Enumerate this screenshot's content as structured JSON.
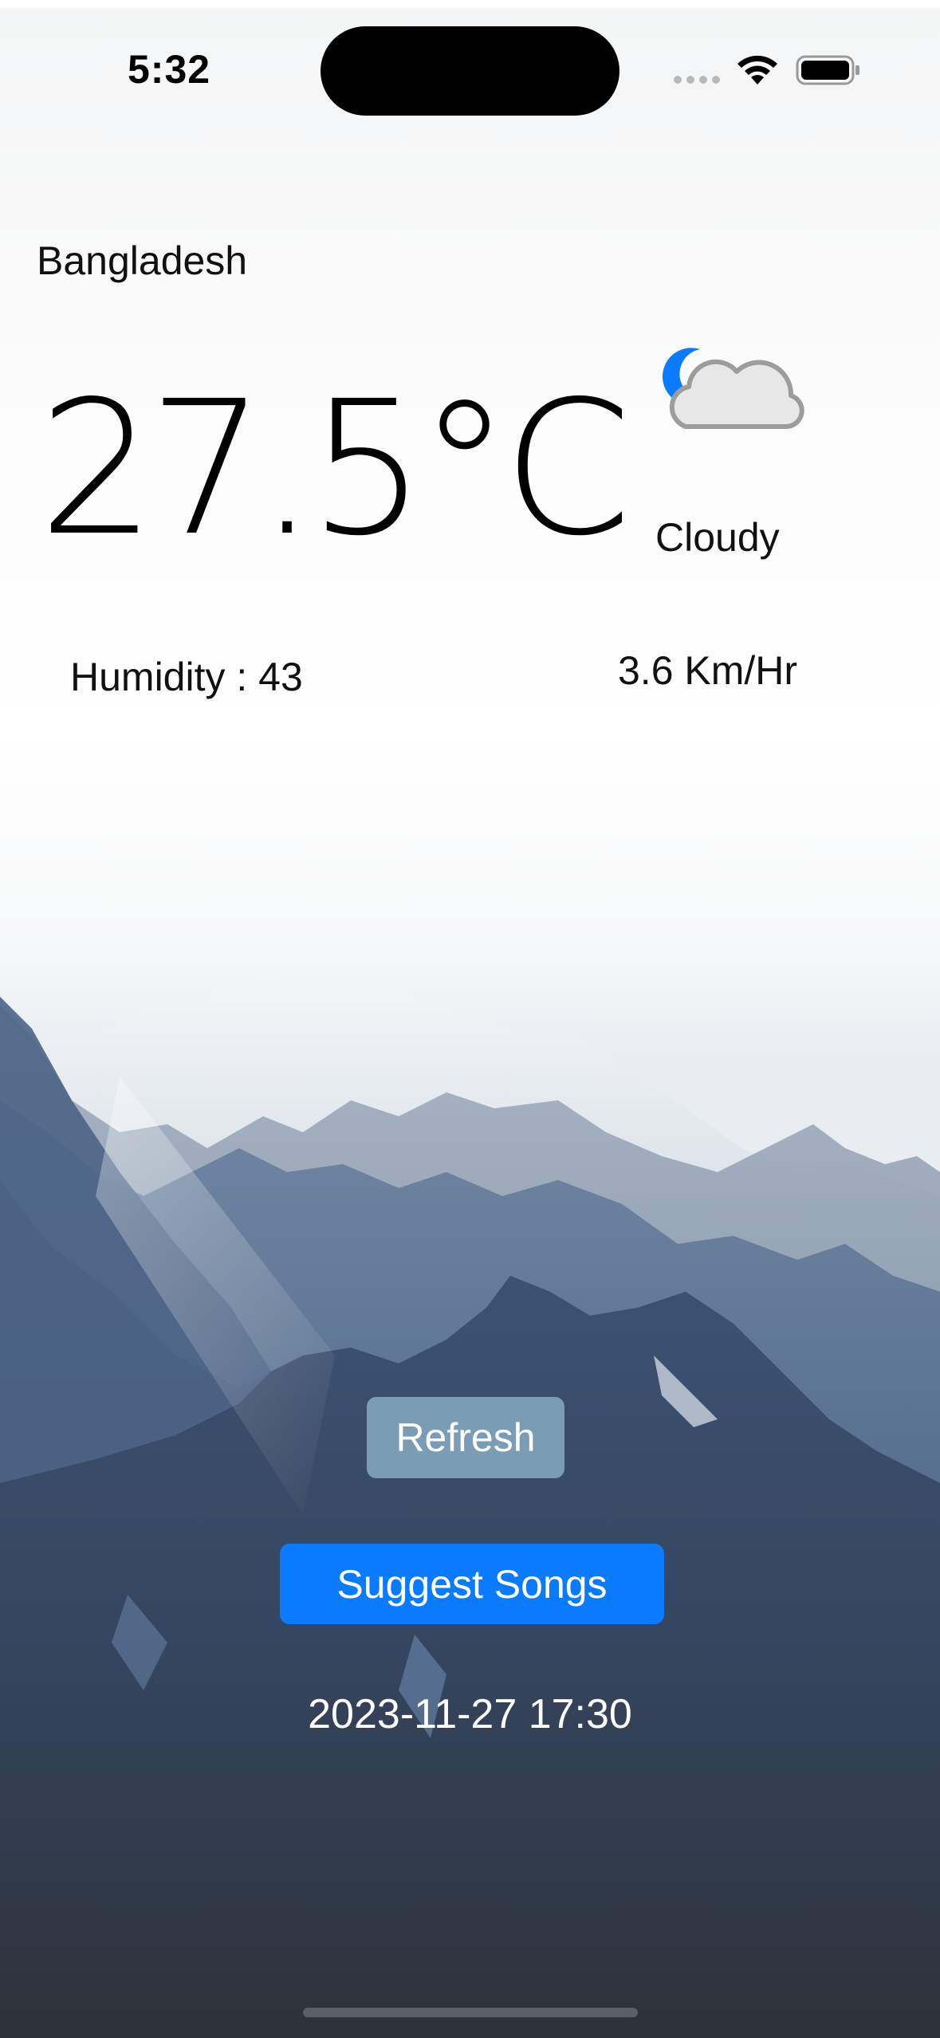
{
  "status_bar": {
    "time": "5:32"
  },
  "weather": {
    "location": "Bangladesh",
    "temperature": "27.5°C",
    "condition": "Cloudy",
    "condition_icon": "moon-cloud-icon",
    "humidity": "Humidity : 43",
    "wind_speed": "3.6 Km/Hr"
  },
  "actions": {
    "refresh_label": "Refresh",
    "suggest_label": "Suggest Songs"
  },
  "timestamp": "2023-11-27 17:30",
  "colors": {
    "accent": "#0a7aff",
    "refresh_button": "#7da0b9",
    "moon": "#0a7aff"
  }
}
